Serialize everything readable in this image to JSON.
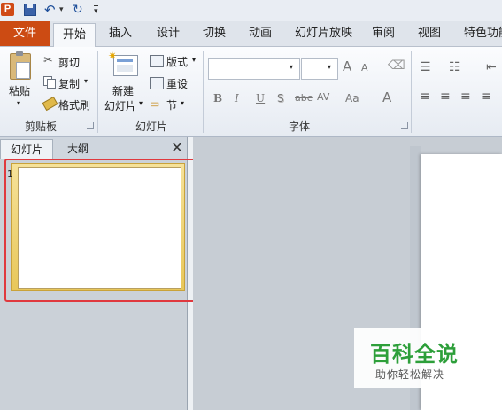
{
  "quick_access": {
    "app_icon": "P",
    "undo_glyph": "↶",
    "redo_glyph": "↻",
    "dropdown_glyph": "▾"
  },
  "tabs": {
    "file": "文件",
    "home": "开始",
    "items": [
      "插入",
      "设计",
      "切换",
      "动画",
      "幻灯片放映",
      "审阅",
      "视图",
      "特色功能"
    ]
  },
  "clipboard": {
    "paste": "粘贴",
    "cut": "剪切",
    "copy": "复制",
    "format_painter": "格式刷",
    "group_label": "剪贴板"
  },
  "slides": {
    "new_slide_line1": "新建",
    "new_slide_line2": "幻灯片",
    "layout": "版式",
    "reset": "重设",
    "section": "节",
    "group_label": "幻灯片"
  },
  "font": {
    "group_label": "字体",
    "grow": "A",
    "shrink": "A",
    "bold": "B",
    "italic": "I",
    "underline": "U",
    "shadow": "S",
    "strike": "abc",
    "spacing": "AV",
    "case": "Aa",
    "color": "A"
  },
  "pane": {
    "tab_slides": "幻灯片",
    "tab_outline": "大纲",
    "close": "✕",
    "slide_number": "1"
  },
  "watermark": {
    "title": "百科全说",
    "subtitle": "助你轻松解决"
  },
  "colors": {
    "file_tab": "#cc4b13",
    "highlight": "#e0393e",
    "watermark_green": "#2d9f3a"
  }
}
